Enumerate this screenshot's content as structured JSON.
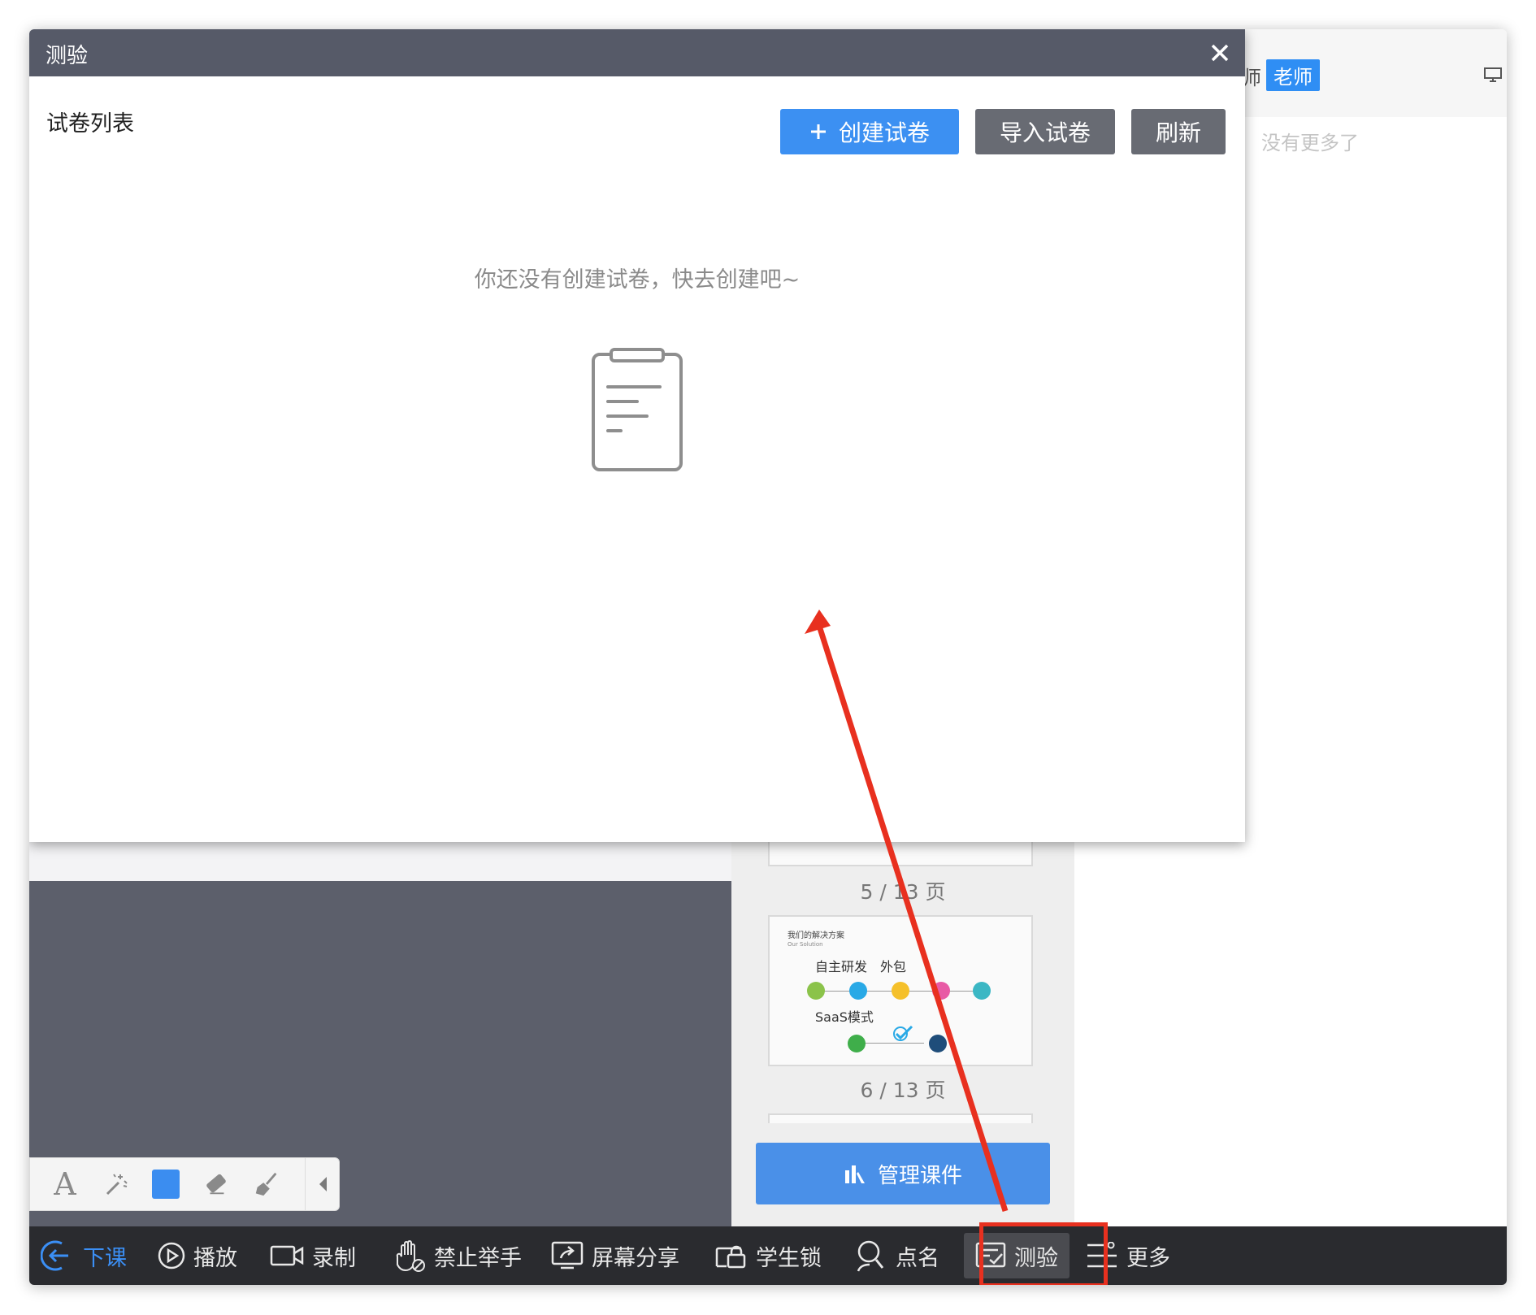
{
  "dialog": {
    "title": "测验",
    "section_title": "试卷列表",
    "buttons": {
      "create": "创建试卷",
      "import": "导入试卷",
      "refresh": "刷新"
    },
    "empty_message": "你还没有创建试卷，快去创建吧~"
  },
  "right_panel": {
    "partial_char": "师",
    "teacher_badge": "老师",
    "no_more": "没有更多了"
  },
  "slides": {
    "page5_label": "5 / 13 页",
    "page6_label": "6 / 13 页",
    "thumb6": {
      "title": "我们的解决方案",
      "subtitle": "Our Solution",
      "text1": "自主研发",
      "text2": "外包",
      "text3": "SaaS模式"
    },
    "manage_button": "管理课件"
  },
  "bottom_bar": {
    "items": [
      {
        "label": "下课",
        "icon": "exit-icon"
      },
      {
        "label": "播放",
        "icon": "play-icon"
      },
      {
        "label": "录制",
        "icon": "video-camera-icon"
      },
      {
        "label": "禁止举手",
        "icon": "hand-icon"
      },
      {
        "label": "屏幕分享",
        "icon": "screen-share-icon"
      },
      {
        "label": "学生锁",
        "icon": "lock-icon"
      },
      {
        "label": "点名",
        "icon": "person-search-icon"
      },
      {
        "label": "测验",
        "icon": "quiz-icon"
      },
      {
        "label": "更多",
        "icon": "more-menu-icon"
      }
    ]
  },
  "draw_toolbar": {
    "text_tool": "A",
    "active_color": "#3b8df0"
  },
  "colors": {
    "accent": "#3c90f2",
    "dialog_header": "#565a68",
    "bottom_bar": "#2a2b2f",
    "annotation_red": "#e8301f"
  }
}
